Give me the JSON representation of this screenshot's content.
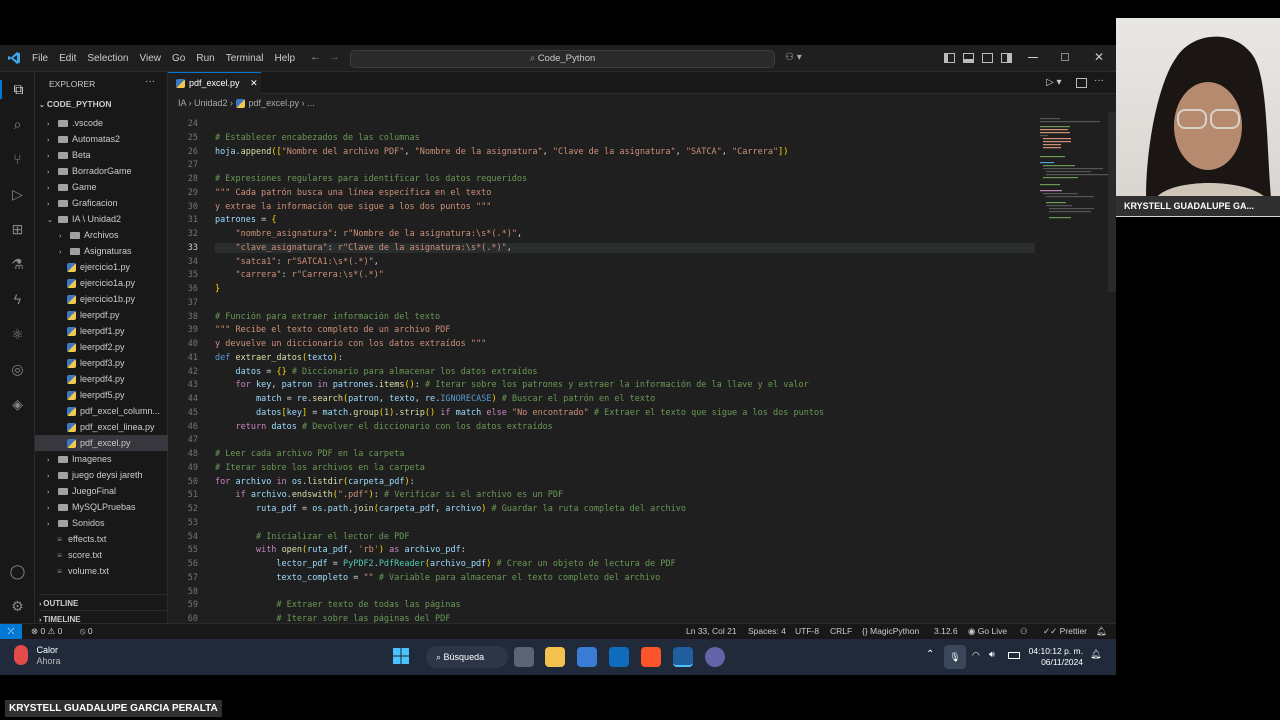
{
  "titlebar": {
    "menu": [
      "File",
      "Edit",
      "Selection",
      "View",
      "Go",
      "Run",
      "Terminal",
      "Help"
    ],
    "search_text": "Code_Python"
  },
  "sidebar": {
    "header": "EXPLORER",
    "root": "CODE_PYTHON",
    "items": [
      {
        "label": ".vscode",
        "kind": "folder",
        "depth": 1,
        "expanded": false
      },
      {
        "label": "Automatas2",
        "kind": "folder",
        "depth": 1,
        "expanded": false
      },
      {
        "label": "Beta",
        "kind": "folder",
        "depth": 1,
        "expanded": false
      },
      {
        "label": "BorradorGame",
        "kind": "folder",
        "depth": 1,
        "expanded": false
      },
      {
        "label": "Game",
        "kind": "folder",
        "depth": 1,
        "expanded": false
      },
      {
        "label": "Graficacion",
        "kind": "folder",
        "depth": 1,
        "expanded": false
      },
      {
        "label": "IA \\ Unidad2",
        "kind": "folder",
        "depth": 1,
        "expanded": true
      },
      {
        "label": "Archivos",
        "kind": "folder",
        "depth": 2,
        "expanded": false
      },
      {
        "label": "Asignaturas",
        "kind": "folder",
        "depth": 2,
        "expanded": false
      },
      {
        "label": "ejercicio1.py",
        "kind": "py",
        "depth": 2
      },
      {
        "label": "ejercicio1a.py",
        "kind": "py",
        "depth": 2
      },
      {
        "label": "ejercicio1b.py",
        "kind": "py",
        "depth": 2
      },
      {
        "label": "leerpdf.py",
        "kind": "py",
        "depth": 2
      },
      {
        "label": "leerpdf1.py",
        "kind": "py",
        "depth": 2
      },
      {
        "label": "leerpdf2.py",
        "kind": "py",
        "depth": 2
      },
      {
        "label": "leerpdf3.py",
        "kind": "py",
        "depth": 2
      },
      {
        "label": "leerpdf4.py",
        "kind": "py",
        "depth": 2
      },
      {
        "label": "leerpdf5.py",
        "kind": "py",
        "depth": 2
      },
      {
        "label": "pdf_excel_column...",
        "kind": "py",
        "depth": 2
      },
      {
        "label": "pdf_excel_linea.py",
        "kind": "py",
        "depth": 2
      },
      {
        "label": "pdf_excel.py",
        "kind": "py",
        "depth": 2,
        "active": true
      },
      {
        "label": "Imagenes",
        "kind": "folder",
        "depth": 1,
        "expanded": false
      },
      {
        "label": "juego deysi jareth",
        "kind": "folder",
        "depth": 1,
        "expanded": false
      },
      {
        "label": "JuegoFinal",
        "kind": "folder",
        "depth": 1,
        "expanded": false
      },
      {
        "label": "MySQLPruebas",
        "kind": "folder",
        "depth": 1,
        "expanded": false
      },
      {
        "label": "Sonidos",
        "kind": "folder",
        "depth": 1,
        "expanded": false
      },
      {
        "label": "effects.txt",
        "kind": "txt",
        "depth": 1
      },
      {
        "label": "score.txt",
        "kind": "txt",
        "depth": 1
      },
      {
        "label": "volume.txt",
        "kind": "txt",
        "depth": 1
      }
    ],
    "outline": "OUTLINE",
    "timeline": "TIMELINE"
  },
  "editor": {
    "tab_label": "pdf_excel.py",
    "breadcrumb": [
      "IA",
      "Unidad2",
      "pdf_excel.py",
      "..."
    ],
    "lines": [
      {
        "n": "24",
        "t": ""
      },
      {
        "n": "25",
        "t": "# Establecer encabezados de las columnas"
      },
      {
        "n": "26",
        "t": "hoja.append([\"Nombre del archivo PDF\", \"Nombre de la asignatura\", \"Clave de la asignatura\", \"SATCA\", \"Carrera\"])"
      },
      {
        "n": "27",
        "t": ""
      },
      {
        "n": "28",
        "t": "# Expresiones regulares para identificar los datos requeridos"
      },
      {
        "n": "29",
        "t": "\"\"\" Cada patrón busca una línea específica en el texto"
      },
      {
        "n": "30",
        "t": "y extrae la información que sigue a los dos puntos \"\"\""
      },
      {
        "n": "31",
        "t": "patrones = {"
      },
      {
        "n": "32",
        "t": "    \"nombre_asignatura\": r\"Nombre de la asignatura:\\s*(.*)\","
      },
      {
        "n": "33",
        "t": "    \"clave_asignatura\": r\"Clave de la asignatura:\\s*(.*)\","
      },
      {
        "n": "34",
        "t": "    \"satca1\": r\"SATCA1:\\s*(.*)\","
      },
      {
        "n": "35",
        "t": "    \"carrera\": r\"Carrera:\\s*(.*)\""
      },
      {
        "n": "36",
        "t": "}"
      },
      {
        "n": "37",
        "t": ""
      },
      {
        "n": "38",
        "t": "# Función para extraer información del texto"
      },
      {
        "n": "39",
        "t": "\"\"\" Recibe el texto completo de un archivo PDF"
      },
      {
        "n": "40",
        "t": "y devuelve un diccionario con los datos extraídos \"\"\""
      },
      {
        "n": "41",
        "t": "def extraer_datos(texto):"
      },
      {
        "n": "42",
        "t": "    datos = {} # Diccionario para almacenar los datos extraídos"
      },
      {
        "n": "43",
        "t": "    for key, patron in patrones.items(): # Iterar sobre los patrones y extraer la información de la llave y el valor"
      },
      {
        "n": "44",
        "t": "        match = re.search(patron, texto, re.IGNORECASE) # Buscar el patrón en el texto"
      },
      {
        "n": "45",
        "t": "        datos[key] = match.group(1).strip() if match else \"No encontrado\" # Extraer el texto que sigue a los dos puntos"
      },
      {
        "n": "46",
        "t": "    return datos # Devolver el diccionario con los datos extraídos"
      },
      {
        "n": "47",
        "t": ""
      },
      {
        "n": "48",
        "t": "# Leer cada archivo PDF en la carpeta"
      },
      {
        "n": "49",
        "t": "# Iterar sobre los archivos en la carpeta"
      },
      {
        "n": "50",
        "t": "for archivo in os.listdir(carpeta_pdf):"
      },
      {
        "n": "51",
        "t": "    if archivo.endswith(\".pdf\"): # Verificar si el archivo es un PDF"
      },
      {
        "n": "52",
        "t": "        ruta_pdf = os.path.join(carpeta_pdf, archivo) # Guardar la ruta completa del archivo"
      },
      {
        "n": "53",
        "t": ""
      },
      {
        "n": "54",
        "t": "        # Inicializar el lector de PDF"
      },
      {
        "n": "55",
        "t": "        with open(ruta_pdf, 'rb') as archivo_pdf:"
      },
      {
        "n": "56",
        "t": "            lector_pdf = PyPDF2.PdfReader(archivo_pdf) # Crear un objeto de lectura de PDF"
      },
      {
        "n": "57",
        "t": "            texto_completo = \"\" # Variable para almacenar el texto completo del archivo"
      },
      {
        "n": "58",
        "t": ""
      },
      {
        "n": "59",
        "t": "            # Extraer texto de todas las páginas"
      },
      {
        "n": "60",
        "t": "            # Iterar sobre las páginas del PDF"
      }
    ],
    "current_line": "33"
  },
  "statusbar": {
    "errors": "0",
    "warnings": "0",
    "ports": "0",
    "position": "Ln 33, Col 21",
    "spaces": "Spaces: 4",
    "encoding": "UTF-8",
    "eol": "CRLF",
    "language": "MagicPython",
    "version": "3.12.6",
    "golive": "Go Live",
    "prettier": "Prettier"
  },
  "taskbar": {
    "weather_title": "Calor",
    "weather_sub": "Ahora",
    "search": "Búsqueda",
    "time": "04:10:12 p. m.",
    "date": "06/11/2024"
  },
  "webcam": {
    "label": "KRYSTELL GUADALUPE GA..."
  },
  "name_bar": "KRYSTELL GUADALUPE GARCIA PERALTA"
}
